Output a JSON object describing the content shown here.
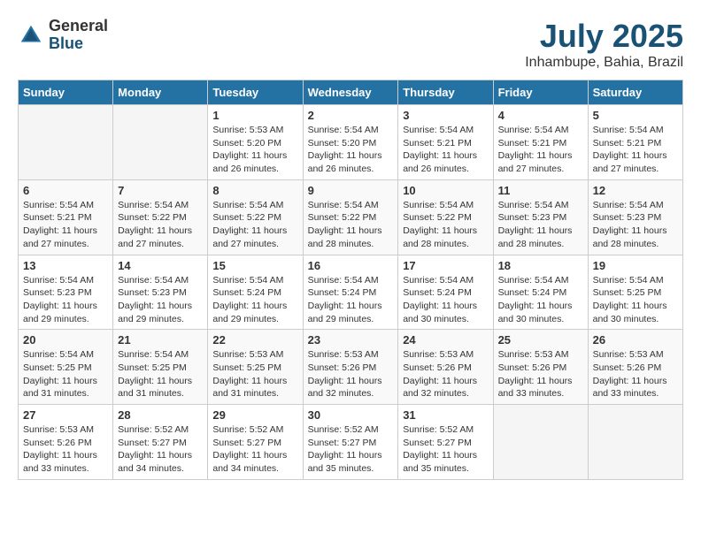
{
  "logo": {
    "general": "General",
    "blue": "Blue"
  },
  "title": {
    "month_year": "July 2025",
    "location": "Inhambupe, Bahia, Brazil"
  },
  "days_of_week": [
    "Sunday",
    "Monday",
    "Tuesday",
    "Wednesday",
    "Thursday",
    "Friday",
    "Saturday"
  ],
  "weeks": [
    [
      {
        "day": "",
        "sunrise": "",
        "sunset": "",
        "daylight": ""
      },
      {
        "day": "",
        "sunrise": "",
        "sunset": "",
        "daylight": ""
      },
      {
        "day": "1",
        "sunrise": "Sunrise: 5:53 AM",
        "sunset": "Sunset: 5:20 PM",
        "daylight": "Daylight: 11 hours and 26 minutes."
      },
      {
        "day": "2",
        "sunrise": "Sunrise: 5:54 AM",
        "sunset": "Sunset: 5:20 PM",
        "daylight": "Daylight: 11 hours and 26 minutes."
      },
      {
        "day": "3",
        "sunrise": "Sunrise: 5:54 AM",
        "sunset": "Sunset: 5:21 PM",
        "daylight": "Daylight: 11 hours and 26 minutes."
      },
      {
        "day": "4",
        "sunrise": "Sunrise: 5:54 AM",
        "sunset": "Sunset: 5:21 PM",
        "daylight": "Daylight: 11 hours and 27 minutes."
      },
      {
        "day": "5",
        "sunrise": "Sunrise: 5:54 AM",
        "sunset": "Sunset: 5:21 PM",
        "daylight": "Daylight: 11 hours and 27 minutes."
      }
    ],
    [
      {
        "day": "6",
        "sunrise": "Sunrise: 5:54 AM",
        "sunset": "Sunset: 5:21 PM",
        "daylight": "Daylight: 11 hours and 27 minutes."
      },
      {
        "day": "7",
        "sunrise": "Sunrise: 5:54 AM",
        "sunset": "Sunset: 5:22 PM",
        "daylight": "Daylight: 11 hours and 27 minutes."
      },
      {
        "day": "8",
        "sunrise": "Sunrise: 5:54 AM",
        "sunset": "Sunset: 5:22 PM",
        "daylight": "Daylight: 11 hours and 27 minutes."
      },
      {
        "day": "9",
        "sunrise": "Sunrise: 5:54 AM",
        "sunset": "Sunset: 5:22 PM",
        "daylight": "Daylight: 11 hours and 28 minutes."
      },
      {
        "day": "10",
        "sunrise": "Sunrise: 5:54 AM",
        "sunset": "Sunset: 5:22 PM",
        "daylight": "Daylight: 11 hours and 28 minutes."
      },
      {
        "day": "11",
        "sunrise": "Sunrise: 5:54 AM",
        "sunset": "Sunset: 5:23 PM",
        "daylight": "Daylight: 11 hours and 28 minutes."
      },
      {
        "day": "12",
        "sunrise": "Sunrise: 5:54 AM",
        "sunset": "Sunset: 5:23 PM",
        "daylight": "Daylight: 11 hours and 28 minutes."
      }
    ],
    [
      {
        "day": "13",
        "sunrise": "Sunrise: 5:54 AM",
        "sunset": "Sunset: 5:23 PM",
        "daylight": "Daylight: 11 hours and 29 minutes."
      },
      {
        "day": "14",
        "sunrise": "Sunrise: 5:54 AM",
        "sunset": "Sunset: 5:23 PM",
        "daylight": "Daylight: 11 hours and 29 minutes."
      },
      {
        "day": "15",
        "sunrise": "Sunrise: 5:54 AM",
        "sunset": "Sunset: 5:24 PM",
        "daylight": "Daylight: 11 hours and 29 minutes."
      },
      {
        "day": "16",
        "sunrise": "Sunrise: 5:54 AM",
        "sunset": "Sunset: 5:24 PM",
        "daylight": "Daylight: 11 hours and 29 minutes."
      },
      {
        "day": "17",
        "sunrise": "Sunrise: 5:54 AM",
        "sunset": "Sunset: 5:24 PM",
        "daylight": "Daylight: 11 hours and 30 minutes."
      },
      {
        "day": "18",
        "sunrise": "Sunrise: 5:54 AM",
        "sunset": "Sunset: 5:24 PM",
        "daylight": "Daylight: 11 hours and 30 minutes."
      },
      {
        "day": "19",
        "sunrise": "Sunrise: 5:54 AM",
        "sunset": "Sunset: 5:25 PM",
        "daylight": "Daylight: 11 hours and 30 minutes."
      }
    ],
    [
      {
        "day": "20",
        "sunrise": "Sunrise: 5:54 AM",
        "sunset": "Sunset: 5:25 PM",
        "daylight": "Daylight: 11 hours and 31 minutes."
      },
      {
        "day": "21",
        "sunrise": "Sunrise: 5:54 AM",
        "sunset": "Sunset: 5:25 PM",
        "daylight": "Daylight: 11 hours and 31 minutes."
      },
      {
        "day": "22",
        "sunrise": "Sunrise: 5:53 AM",
        "sunset": "Sunset: 5:25 PM",
        "daylight": "Daylight: 11 hours and 31 minutes."
      },
      {
        "day": "23",
        "sunrise": "Sunrise: 5:53 AM",
        "sunset": "Sunset: 5:26 PM",
        "daylight": "Daylight: 11 hours and 32 minutes."
      },
      {
        "day": "24",
        "sunrise": "Sunrise: 5:53 AM",
        "sunset": "Sunset: 5:26 PM",
        "daylight": "Daylight: 11 hours and 32 minutes."
      },
      {
        "day": "25",
        "sunrise": "Sunrise: 5:53 AM",
        "sunset": "Sunset: 5:26 PM",
        "daylight": "Daylight: 11 hours and 33 minutes."
      },
      {
        "day": "26",
        "sunrise": "Sunrise: 5:53 AM",
        "sunset": "Sunset: 5:26 PM",
        "daylight": "Daylight: 11 hours and 33 minutes."
      }
    ],
    [
      {
        "day": "27",
        "sunrise": "Sunrise: 5:53 AM",
        "sunset": "Sunset: 5:26 PM",
        "daylight": "Daylight: 11 hours and 33 minutes."
      },
      {
        "day": "28",
        "sunrise": "Sunrise: 5:52 AM",
        "sunset": "Sunset: 5:27 PM",
        "daylight": "Daylight: 11 hours and 34 minutes."
      },
      {
        "day": "29",
        "sunrise": "Sunrise: 5:52 AM",
        "sunset": "Sunset: 5:27 PM",
        "daylight": "Daylight: 11 hours and 34 minutes."
      },
      {
        "day": "30",
        "sunrise": "Sunrise: 5:52 AM",
        "sunset": "Sunset: 5:27 PM",
        "daylight": "Daylight: 11 hours and 35 minutes."
      },
      {
        "day": "31",
        "sunrise": "Sunrise: 5:52 AM",
        "sunset": "Sunset: 5:27 PM",
        "daylight": "Daylight: 11 hours and 35 minutes."
      },
      {
        "day": "",
        "sunrise": "",
        "sunset": "",
        "daylight": ""
      },
      {
        "day": "",
        "sunrise": "",
        "sunset": "",
        "daylight": ""
      }
    ]
  ]
}
